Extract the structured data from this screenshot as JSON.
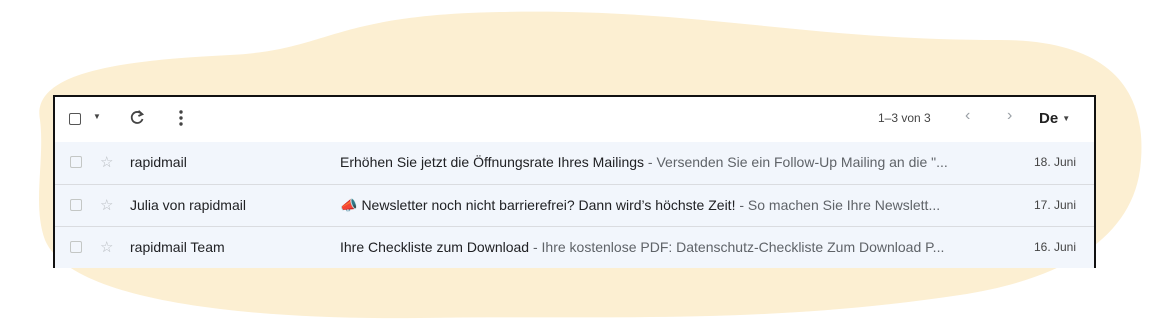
{
  "colors": {
    "background_blob": "#fcefd2",
    "row_background": "#f2f6fc",
    "panel_border": "#111111"
  },
  "toolbar": {
    "select_icon": "checkbox-icon",
    "dropdown_icon": "caret-down-icon",
    "refresh_icon": "refresh-icon",
    "more_icon": "more-vert-icon",
    "pagination": "1–3 von 3",
    "prev_icon": "chevron-left-icon",
    "next_icon": "chevron-right-icon",
    "language_label": "De",
    "language_dropdown_icon": "caret-down-icon"
  },
  "emails": [
    {
      "sender": "rapidmail",
      "emoji": "",
      "subject": "Erhöhen Sie jetzt die Öffnungsrate Ihres Mailings",
      "snippet": " - Versenden Sie ein Follow-Up Mailing an die \"...",
      "date": "18. Juni"
    },
    {
      "sender": "Julia von rapidmail",
      "emoji": "📣",
      "subject": "Newsletter noch nicht barrierefrei? Dann wird’s höchste Zeit!",
      "snippet": " - So machen Sie Ihre Newslett...",
      "date": "17. Juni"
    },
    {
      "sender": "rapidmail Team",
      "emoji": "",
      "subject": "Ihre Checkliste zum Download",
      "snippet": " - Ihre kostenlose PDF: Datenschutz-Checkliste Zum Download P...",
      "date": "16. Juni"
    }
  ]
}
